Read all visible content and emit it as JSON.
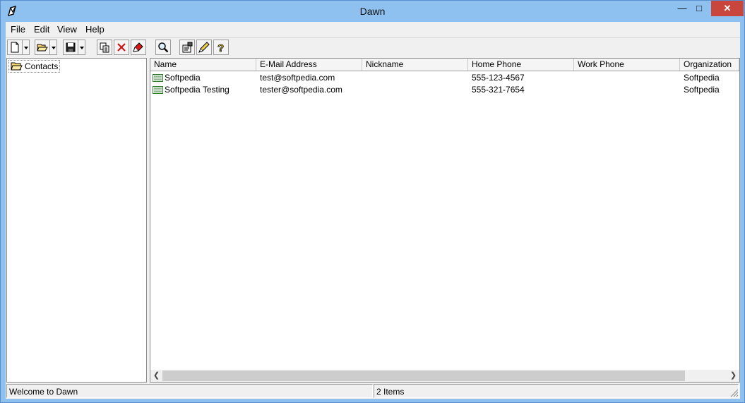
{
  "window": {
    "title": "Dawn"
  },
  "menu": [
    {
      "label": "File"
    },
    {
      "label": "Edit"
    },
    {
      "label": "View"
    },
    {
      "label": "Help"
    }
  ],
  "toolbar": [
    {
      "name": "new-button",
      "icon": "new-file-icon"
    },
    {
      "name": "open-button",
      "icon": "open-folder-icon"
    },
    {
      "name": "save-button",
      "icon": "save-disk-icon"
    },
    {
      "name": "copy-button",
      "icon": "copy-icon"
    },
    {
      "name": "delete-button",
      "icon": "delete-x-icon"
    },
    {
      "name": "erase-button",
      "icon": "eraser-icon"
    },
    {
      "name": "find-button",
      "icon": "magnifier-icon"
    },
    {
      "name": "properties-button",
      "icon": "properties-icon"
    },
    {
      "name": "edit-button",
      "icon": "pencil-icon"
    },
    {
      "name": "help-button",
      "icon": "question-icon"
    }
  ],
  "tree": {
    "root_label": "Contacts"
  },
  "list": {
    "columns": [
      "Name",
      "E-Mail Address",
      "Nickname",
      "Home Phone",
      "Work Phone",
      "Organization"
    ],
    "rows": [
      {
        "name": "Softpedia",
        "email": "test@softpedia.com",
        "nickname": "",
        "home_phone": "555-123-4567",
        "work_phone": "",
        "organization": "Softpedia"
      },
      {
        "name": "Softpedia Testing",
        "email": "tester@softpedia.com",
        "nickname": "",
        "home_phone": "555-321-7654",
        "work_phone": "",
        "organization": "Softpedia"
      }
    ]
  },
  "status": {
    "message": "Welcome to Dawn",
    "count": "2 Items"
  },
  "colors": {
    "titlebar": "#8ec1f0",
    "close_button": "#c9463d",
    "scroll_thumb": "#cdcdcd"
  }
}
